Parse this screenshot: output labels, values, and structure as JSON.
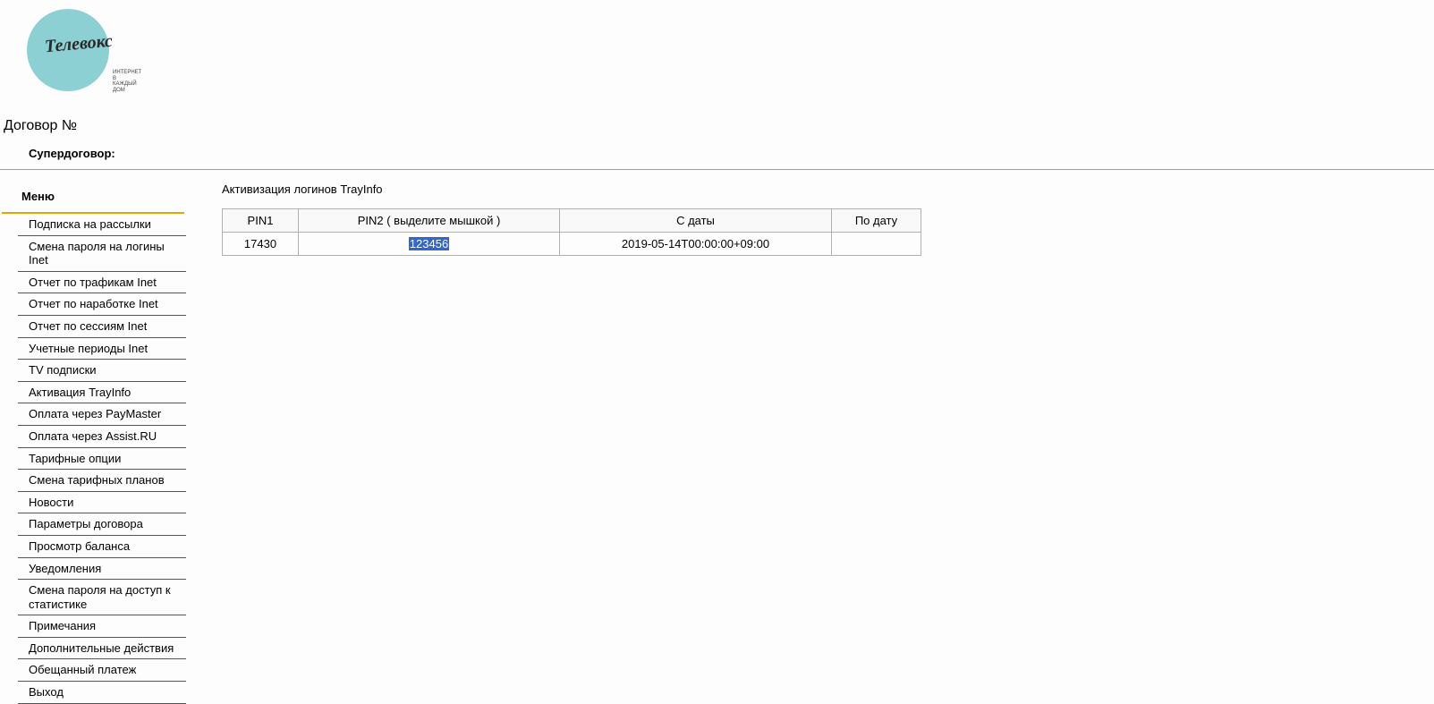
{
  "logo": {
    "brand": "Телевокс",
    "tagline1": "ИНТЕРНЕТ",
    "tagline2": "В КАЖДЫЙ ДОМ"
  },
  "header": {
    "contract": "Договор №",
    "super": "Супердоговор:"
  },
  "sidebar": {
    "title": "Меню",
    "items": [
      {
        "label": "Подписка на рассылки"
      },
      {
        "label": "Смена пароля на логины Inet"
      },
      {
        "label": "Отчет по трафикам Inet"
      },
      {
        "label": "Отчет по наработке Inet"
      },
      {
        "label": "Отчет по сессиям Inet"
      },
      {
        "label": "Учетные периоды Inet"
      },
      {
        "label": "TV подписки"
      },
      {
        "label": "Активация TrayInfo"
      },
      {
        "label": "Оплата через PayMaster"
      },
      {
        "label": "Оплата через Assist.RU"
      },
      {
        "label": "Тарифные опции"
      },
      {
        "label": "Смена тарифных планов"
      },
      {
        "label": "Новости"
      },
      {
        "label": "Параметры договора"
      },
      {
        "label": "Просмотр баланса"
      },
      {
        "label": "Уведомления"
      },
      {
        "label": "Смена пароля на доступ к статистике"
      },
      {
        "label": "Примечания"
      },
      {
        "label": "Дополнительные действия"
      },
      {
        "label": "Обещанный платеж"
      },
      {
        "label": "Выход"
      }
    ]
  },
  "main": {
    "title": "Активизация логинов TrayInfo",
    "table": {
      "headers": {
        "pin1": "PIN1",
        "pin2": "PIN2 ( выделите мышкой )",
        "from": "С даты",
        "to": "По дату"
      },
      "row": {
        "pin1": "17430",
        "pin2": "123456",
        "from": "2019-05-14T00:00:00+09:00",
        "to": ""
      }
    }
  }
}
